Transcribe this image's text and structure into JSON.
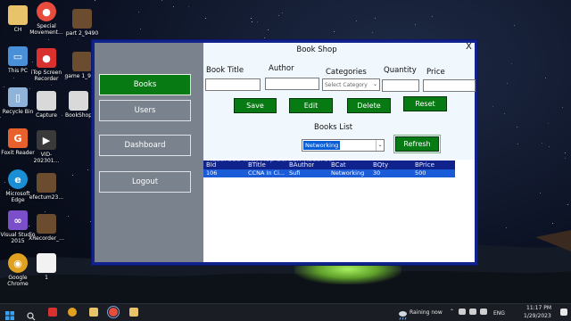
{
  "desktop": {
    "icons": [
      {
        "label": "CH",
        "color": "#e8c36a",
        "glyph": ""
      },
      {
        "label": "Special Movement...",
        "color": "#e84c3d",
        "glyph": "●"
      },
      {
        "label": "part 2_9490",
        "color": "#6b4c2f",
        "glyph": ""
      },
      {
        "label": "This PC",
        "color": "#4a90d9",
        "glyph": "▭"
      },
      {
        "label": "iTop Screen Recorder",
        "color": "#d93030",
        "glyph": "●"
      },
      {
        "label": "game 1_91...",
        "color": "#6b4c2f",
        "glyph": ""
      },
      {
        "label": "Recycle Bin",
        "color": "#8fb3d9",
        "glyph": "▯"
      },
      {
        "label": "Capture",
        "color": "#d9d9d9",
        "glyph": ""
      },
      {
        "label": "BookShop",
        "color": "#d9d9d9",
        "glyph": ""
      },
      {
        "label": "Foxit Reader",
        "color": "#e8602c",
        "glyph": "G"
      },
      {
        "label": "VID-202301...",
        "color": "#3a3a3a",
        "glyph": "▶"
      },
      {
        "label": "Microsoft Edge",
        "color": "#1a8fd6",
        "glyph": "e"
      },
      {
        "label": "efectum23...",
        "color": "#6b4c2f",
        "glyph": ""
      },
      {
        "label": "Visual Studio 2015",
        "color": "#7b4fc9",
        "glyph": "∞"
      },
      {
        "label": "XRecorder_...",
        "color": "#6b4c2f",
        "glyph": ""
      },
      {
        "label": "Google Chrome",
        "color": "#e0a020",
        "glyph": "◉"
      },
      {
        "label": "1",
        "color": "#f2f2f2",
        "glyph": ""
      }
    ]
  },
  "app": {
    "title": "Book Shop",
    "close_label": "X",
    "sidebar": {
      "books_label": "Books",
      "users_label": "Users",
      "dashboard_label": "Dashboard",
      "logout_label": "Logout"
    },
    "form": {
      "book_title_label": "Book Title",
      "author_label": "Author",
      "categories_label": "Categories",
      "quantity_label": "Quantity",
      "price_label": "Price",
      "category_placeholder": "Select Category",
      "book_title_value": "",
      "author_value": "",
      "quantity_value": "",
      "price_value": ""
    },
    "buttons": {
      "save": "Save",
      "edit": "Edit",
      "delete": "Delete",
      "reset": "Reset",
      "refresh": "Refresh"
    },
    "books_list_label": "Books List",
    "filter_value": "Networking",
    "watermark": "Recorded with iTop Screen Recorder",
    "table": {
      "columns": [
        "BId",
        "BTitle",
        "BAuthor",
        "BCat",
        "BQty",
        "BPrice"
      ],
      "rows": [
        [
          "106",
          "CCNA In Ci...",
          "Sufi",
          "Networking",
          "30",
          "500"
        ]
      ]
    }
  },
  "taskbar": {
    "weather": "Raining now",
    "language": "ENG",
    "time": "11:17 PM",
    "date": "1/29/2023"
  }
}
